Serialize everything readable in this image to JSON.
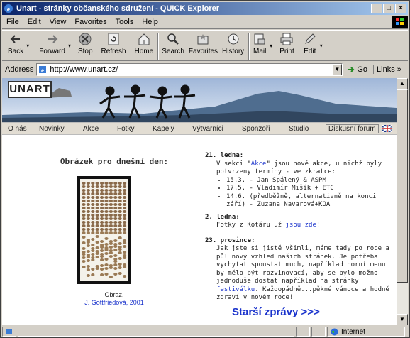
{
  "window": {
    "title": "Unart - stránky občanského sdružení - QUICK Explorer"
  },
  "menu": [
    "File",
    "Edit",
    "View",
    "Favorites",
    "Tools",
    "Help"
  ],
  "toolbar": [
    {
      "label": "Back",
      "icon": "back-arrow-icon"
    },
    {
      "label": "Forward",
      "icon": "forward-arrow-icon"
    },
    {
      "label": "Stop",
      "icon": "stop-icon"
    },
    {
      "label": "Refresh",
      "icon": "refresh-icon"
    },
    {
      "label": "Home",
      "icon": "home-icon"
    },
    {
      "label": "Search",
      "icon": "search-icon"
    },
    {
      "label": "Favorites",
      "icon": "favorites-icon"
    },
    {
      "label": "History",
      "icon": "history-icon"
    },
    {
      "label": "Mail",
      "icon": "mail-icon"
    },
    {
      "label": "Print",
      "icon": "print-icon"
    },
    {
      "label": "Edit",
      "icon": "edit-icon"
    }
  ],
  "address": {
    "label": "Address",
    "url": "http://www.unart.cz/",
    "go": "Go",
    "links": "Links"
  },
  "site": {
    "logo": "UNART",
    "nav": [
      "O nás",
      "Novinky",
      "Akce",
      "Fotky",
      "Kapely",
      "Výtvarníci",
      "Sponzoři",
      "Studio",
      "Diskusní forum"
    ],
    "image_title": "Obrázek pro dnešní den:",
    "caption_line1": "Obraz,",
    "caption_line2": "J. Gottfriedová, 2001",
    "news": [
      {
        "date": "21. ledna:",
        "before": "V sekci \"",
        "link": "Akce",
        "after": "\" jsou nové akce, u nichž byly potvrzeny termíny - ve zkratce:",
        "items": [
          "15.3. - Jan Spálený & ASPM",
          "17.5. - Vladimír Mišík + ETC",
          "14.6. (předběžně, alternativně na konci září) - Zuzana Navarová+KOA"
        ]
      },
      {
        "date": "2. ledna:",
        "before": "Fotky z Kotáru už ",
        "link": "jsou zde",
        "after": "!"
      },
      {
        "date": "23. prosince:",
        "before": "Jak jste si jistě všimli, máme tady po roce a půl nový vzhled našich stránek. Je potřeba vychytat spoustat much, například horní menu by mělo být rozvinovací, aby se bylo možno jednoduše dostat například na stránky ",
        "link": "festiválku",
        "after": ". Každopádně...pěkné vánoce a hodně zdraví v novém roce!"
      }
    ],
    "older": "Starší zprávy >>>"
  },
  "status": {
    "zone": "Internet"
  }
}
